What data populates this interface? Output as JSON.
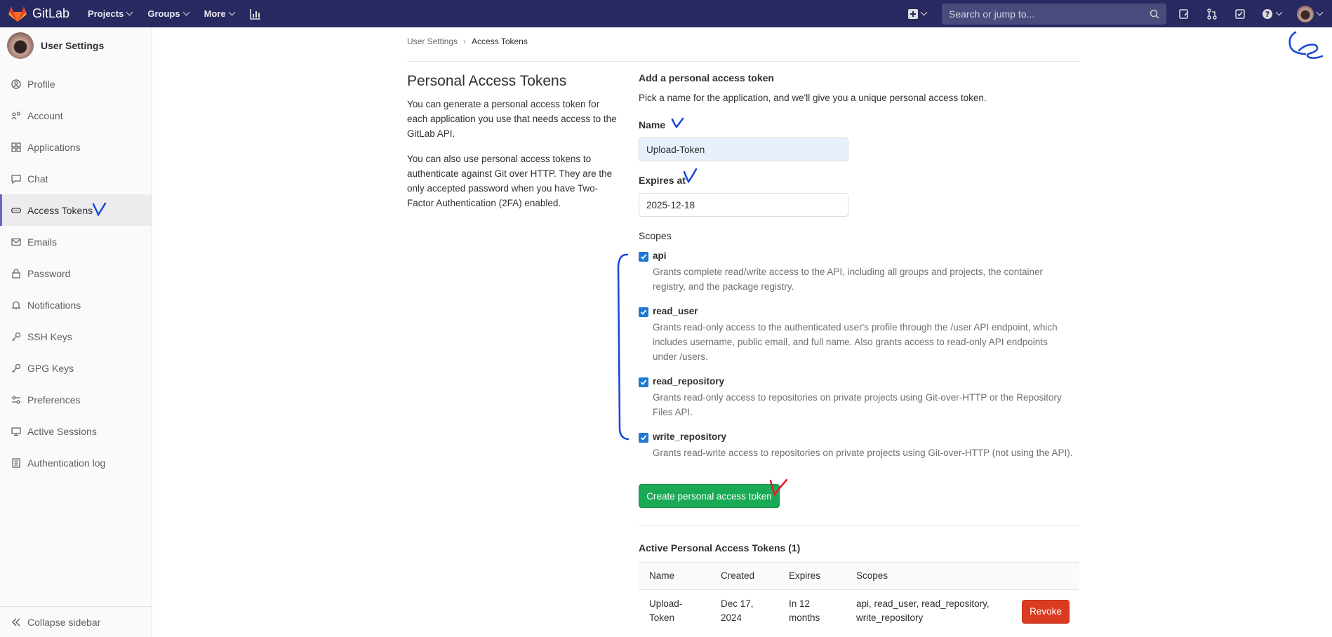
{
  "topnav": {
    "app_name": "GitLab",
    "links": [
      "Projects",
      "Groups",
      "More"
    ],
    "search_placeholder": "Search or jump to...",
    "brand_color": "#292961"
  },
  "sidebar": {
    "title": "User Settings",
    "items": [
      {
        "label": "Profile",
        "icon": "profile-icon"
      },
      {
        "label": "Account",
        "icon": "account-icon"
      },
      {
        "label": "Applications",
        "icon": "applications-icon"
      },
      {
        "label": "Chat",
        "icon": "chat-icon"
      },
      {
        "label": "Access Tokens",
        "icon": "token-icon",
        "active": true
      },
      {
        "label": "Emails",
        "icon": "mail-icon"
      },
      {
        "label": "Password",
        "icon": "lock-icon"
      },
      {
        "label": "Notifications",
        "icon": "bell-icon"
      },
      {
        "label": "SSH Keys",
        "icon": "key-icon"
      },
      {
        "label": "GPG Keys",
        "icon": "key-icon"
      },
      {
        "label": "Preferences",
        "icon": "preferences-icon"
      },
      {
        "label": "Active Sessions",
        "icon": "monitor-icon"
      },
      {
        "label": "Authentication log",
        "icon": "log-icon"
      }
    ],
    "collapse_label": "Collapse sidebar"
  },
  "breadcrumb": [
    "User Settings",
    "Access Tokens"
  ],
  "intro": {
    "title": "Personal Access Tokens",
    "p1": "You can generate a personal access token for each application you use that needs access to the GitLab API.",
    "p2": "You can also use personal access tokens to authenticate against Git over HTTP. They are the only accepted password when you have Two-Factor Authentication (2FA) enabled."
  },
  "form": {
    "title": "Add a personal access token",
    "description": "Pick a name for the application, and we'll give you a unique personal access token.",
    "name_label": "Name",
    "name_value": "Upload-Token",
    "expires_label": "Expires at",
    "expires_value": "2025-12-18",
    "scopes_label": "Scopes",
    "scopes": [
      {
        "name": "api",
        "checked": true,
        "description": "Grants complete read/write access to the API, including all groups and projects, the container registry, and the package registry."
      },
      {
        "name": "read_user",
        "checked": true,
        "description": "Grants read-only access to the authenticated user's profile through the /user API endpoint, which includes username, public email, and full name. Also grants access to read-only API endpoints under /users."
      },
      {
        "name": "read_repository",
        "checked": true,
        "description": "Grants read-only access to repositories on private projects using Git-over-HTTP or the Repository Files API."
      },
      {
        "name": "write_repository",
        "checked": true,
        "description": "Grants read-write access to repositories on private projects using Git-over-HTTP (not using the API)."
      }
    ],
    "submit_label": "Create personal access token",
    "submit_color": "#1aaa55"
  },
  "active_tokens": {
    "title": "Active Personal Access Tokens (1)",
    "columns": [
      "Name",
      "Created",
      "Expires",
      "Scopes"
    ],
    "rows": [
      {
        "name": "Upload-Token",
        "created": "Dec 17, 2024",
        "expires": "In 12 months",
        "scopes": "api, read_user, read_repository, write_repository",
        "action": "Revoke"
      }
    ],
    "revoke_color": "#db3b21"
  }
}
